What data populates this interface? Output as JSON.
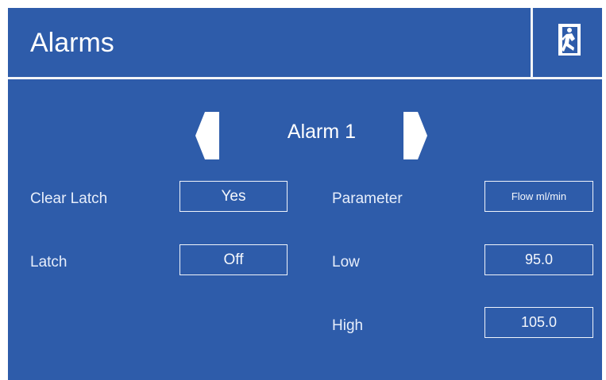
{
  "header": {
    "title": "Alarms",
    "exit_icon": "exit-door-icon"
  },
  "navigation": {
    "alarm_name": "Alarm 1",
    "previous_icon": "arrow-left-icon",
    "next_icon": "arrow-right-icon"
  },
  "settings": {
    "clear_latch": {
      "label": "Clear Latch",
      "value": "Yes"
    },
    "latch": {
      "label": "Latch",
      "value": "Off"
    },
    "parameter": {
      "label": "Parameter",
      "value": "Flow ml/min"
    },
    "low": {
      "label": "Low",
      "value": "95.0"
    },
    "high": {
      "label": "High",
      "value": "105.0"
    }
  },
  "colors": {
    "background": "#2e5caa",
    "foreground": "#ffffff"
  }
}
